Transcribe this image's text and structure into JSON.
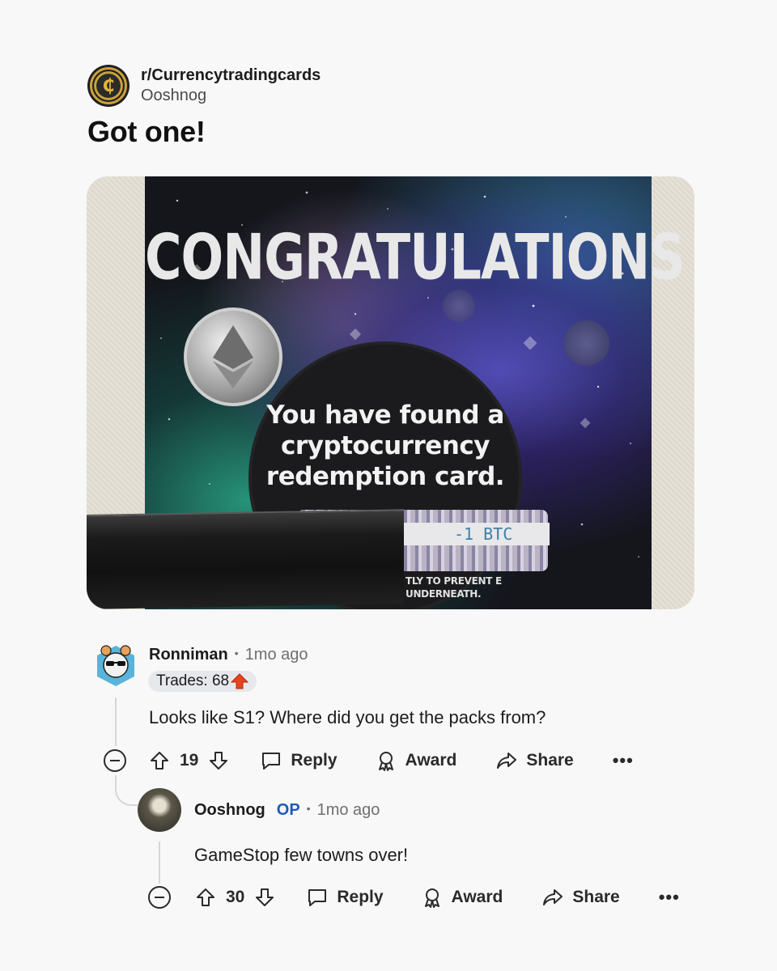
{
  "subreddit": {
    "name": "r/Currencytradingcards",
    "author": "Ooshnog",
    "avatar_icon": "currency-coin-icon"
  },
  "post": {
    "title": "Got one!",
    "image": {
      "headline": "CONGRATULATIONS",
      "message": "You have found a cryptocurrency redemption card.",
      "scratch_value": "-1 BTC",
      "fine_print": "TLY TO PREVENT E UNDERNEATH."
    }
  },
  "comments": [
    {
      "author": "Ronniman",
      "time": "1mo ago",
      "flair": "Trades: 68",
      "flair_icon": "red-up-arrow-icon",
      "body": "Looks like S1? Where did you get the packs from?",
      "votes": "19",
      "reply_label": "Reply",
      "award_label": "Award",
      "share_label": "Share",
      "more_label": "•••"
    },
    {
      "author": "Ooshnog",
      "badge": "OP",
      "time": "1mo ago",
      "body": "GameStop few towns over!",
      "votes": "30",
      "reply_label": "Reply",
      "award_label": "Award",
      "share_label": "Share",
      "more_label": "•••"
    }
  ],
  "colors": {
    "background": "#f8f8f8",
    "op_badge": "#1e5bb8",
    "flair_bg": "#e6e8ec",
    "flair_arrow": "#e8431c"
  }
}
